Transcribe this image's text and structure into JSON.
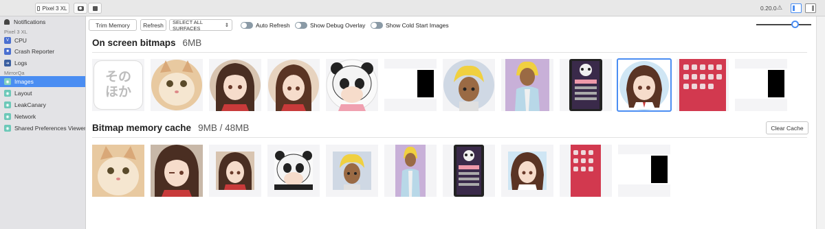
{
  "toolbar": {
    "device_label": "Pixel 3 XL",
    "version": "0.20.0",
    "warning_glyph": "⚠"
  },
  "sidebar": {
    "notifications": "Notifications",
    "device_header": "Pixel 3 XL",
    "device_items": [
      {
        "label": "CPU",
        "icon": "cpu-icon",
        "color": "#4a6fd0"
      },
      {
        "label": "Crash Reporter",
        "icon": "crash-reporter-icon",
        "color": "#4a6fd0"
      },
      {
        "label": "Logs",
        "icon": "logs-icon",
        "color": "#3a5fa0"
      }
    ],
    "app_header": "MirrorQa",
    "app_items": [
      {
        "label": "Images",
        "icon": "images-icon",
        "color": "#7fd0c0"
      },
      {
        "label": "Layout",
        "icon": "layout-icon",
        "color": "#6cc8b8"
      },
      {
        "label": "LeakCanary",
        "icon": "leakcanary-icon",
        "color": "#6cc8b8"
      },
      {
        "label": "Network",
        "icon": "network-icon",
        "color": "#6cc8b8"
      },
      {
        "label": "Shared Preferences Viewer",
        "icon": "shared-preferences-icon",
        "color": "#6cc8b8"
      }
    ]
  },
  "controls": {
    "trim_memory": "Trim Memory",
    "refresh": "Refresh",
    "surfaces_select": "SELECT ALL SURFACES",
    "auto_refresh": "Auto Refresh",
    "show_debug_overlay": "Show Debug Overlay",
    "show_cold_start_images": "Show Cold Start Images",
    "zoom_level": 0.7
  },
  "on_screen": {
    "title": "On screen bitmaps",
    "size": "6MB",
    "sonota_line1": "その",
    "sonota_line2": "ほか",
    "images": [
      "sonota",
      "cat",
      "anime-girl-brown-hair",
      "anime-girl-brown-hair-2",
      "panda-hood-girl",
      "black-rectangle",
      "blonde-boy",
      "blonde-boy-standing",
      "phone-screenshot-panda",
      "anime-girl-selected",
      "phone-home-screen",
      "black-rectangle-2"
    ]
  },
  "cache": {
    "title": "Bitmap memory cache",
    "size": "9MB / 48MB",
    "clear_button": "Clear Cache",
    "images": [
      "cat",
      "anime-girl-wink",
      "anime-girl-brown-hair",
      "panda-hood-girl",
      "blonde-boy",
      "blonde-boy-standing",
      "phone-screenshot-panda",
      "anime-girl",
      "phone-home-screen",
      "black-rectangle"
    ]
  }
}
